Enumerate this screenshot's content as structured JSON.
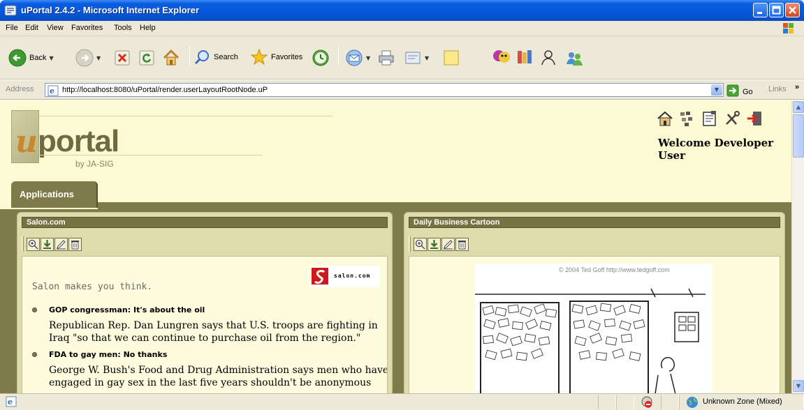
{
  "window": {
    "title": "uPortal 2.4.2 - Microsoft Internet Explorer"
  },
  "menu": [
    "File",
    "Edit",
    "View",
    "Favorites",
    "Tools",
    "Help"
  ],
  "toolbar": {
    "back_label": "Back",
    "search_label": "Search",
    "favorites_label": "Favorites"
  },
  "address": {
    "label": "Address",
    "url": "http://localhost:8080/uPortal/render.userLayoutRootNode.uP",
    "go_label": "Go",
    "links_label": "Links",
    "links_chevron": "»"
  },
  "portal": {
    "logo_u": "u",
    "logo_portal": "portal",
    "logo_by": "by JA-SIG",
    "header_icons": [
      "home-icon",
      "layout-icon",
      "preferences-icon",
      "tools-icon",
      "logout-icon"
    ],
    "welcome": "Welcome Developer User",
    "tab_label": "Applications",
    "colors": {
      "page_bg": "#fbfad2",
      "accent": "#7e7a49",
      "channel_bg": "#dedcad"
    }
  },
  "channels": [
    {
      "title": "Salon.com",
      "tagline": "Salon makes you think.",
      "logo_text": "salon.com",
      "news": [
        {
          "headline": "GOP congressman: It's about the oil",
          "summary": "Republican Rep. Dan Lungren says that U.S. troops are fighting in Iraq \"so that we can continue to purchase oil from the region.\""
        },
        {
          "headline": "FDA to gay men: No thanks",
          "summary": "George W. Bush's Food and Drug Administration says men who have engaged in gay sex in the last five years shouldn't be anonymous"
        }
      ]
    },
    {
      "title": "Daily Business Cartoon",
      "credit": "© 2004 Ted Goff http://www.tedgoff.com"
    }
  ],
  "channel_tools": [
    "zoom-icon",
    "minimize-icon",
    "edit-icon",
    "remove-icon"
  ],
  "status": {
    "zone": "Unknown Zone (Mixed)"
  }
}
